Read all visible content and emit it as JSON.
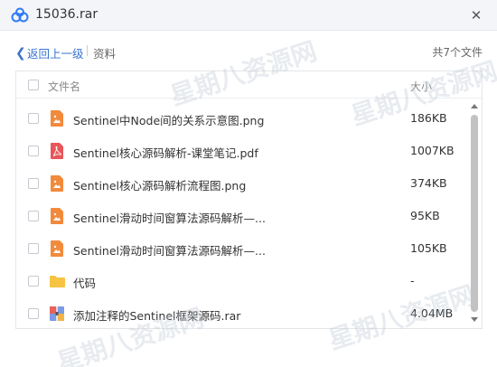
{
  "window": {
    "title": "15036.rar"
  },
  "toolbar": {
    "back_label": "返回上一级",
    "crumb": "资料",
    "count_label": "共7个文件"
  },
  "list": {
    "header": {
      "name": "文件名",
      "size": "大小"
    },
    "files": [
      {
        "name": "Sentinel中Node间的关系示意图.png",
        "size": "186KB",
        "icon": "image-file-icon"
      },
      {
        "name": "Sentinel核心源码解析-课堂笔记.pdf",
        "size": "1007KB",
        "icon": "pdf-file-icon"
      },
      {
        "name": "Sentinel核心源码解析流程图.png",
        "size": "374KB",
        "icon": "image-file-icon"
      },
      {
        "name": "Sentinel滑动时间窗算法源码解析—...",
        "size": "95KB",
        "icon": "image-file-icon"
      },
      {
        "name": "Sentinel滑动时间窗算法源码解析—...",
        "size": "105KB",
        "icon": "image-file-icon"
      },
      {
        "name": "代码",
        "size": "-",
        "icon": "folder-icon"
      },
      {
        "name": "添加注释的Sentinel框架源码.rar",
        "size": "4.04MB",
        "icon": "archive-file-icon"
      }
    ]
  },
  "watermark": {
    "text": "星期八资源网"
  },
  "colors": {
    "accent": "#3a74cf",
    "image": "#f28a3c",
    "pdf": "#e8555a",
    "folder": "#f6c343"
  }
}
